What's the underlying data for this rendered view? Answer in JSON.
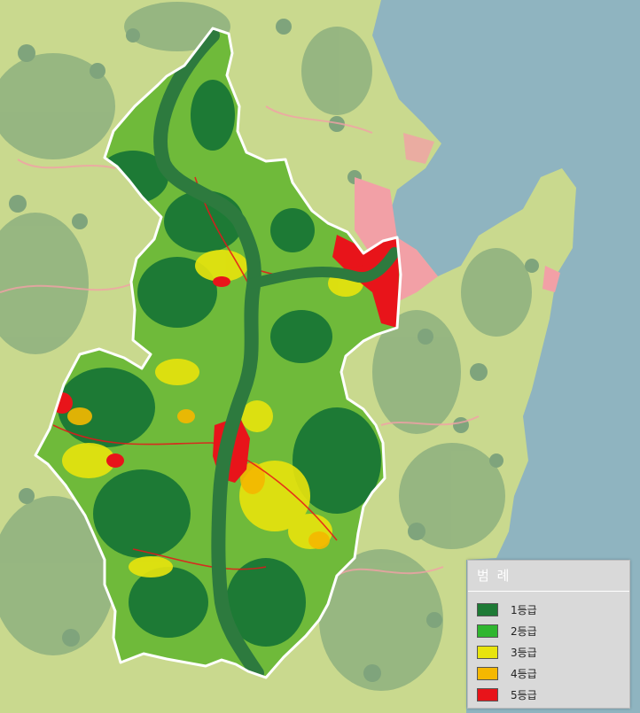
{
  "legend": {
    "title": "범 례",
    "items": [
      {
        "label": "1등급",
        "color": "#1d7a35"
      },
      {
        "label": "2등급",
        "color": "#2fb62f"
      },
      {
        "label": "3등급",
        "color": "#e8e40d"
      },
      {
        "label": "4등급",
        "color": "#f5b800"
      },
      {
        "label": "5등급",
        "color": "#e8141a"
      }
    ]
  },
  "colors": {
    "sea": "#8fb4c0",
    "background_land": "#c9d98e",
    "background_forest": "#8eb07f",
    "urban": "#f2a0a6",
    "region_boundary": "#ffffff"
  }
}
